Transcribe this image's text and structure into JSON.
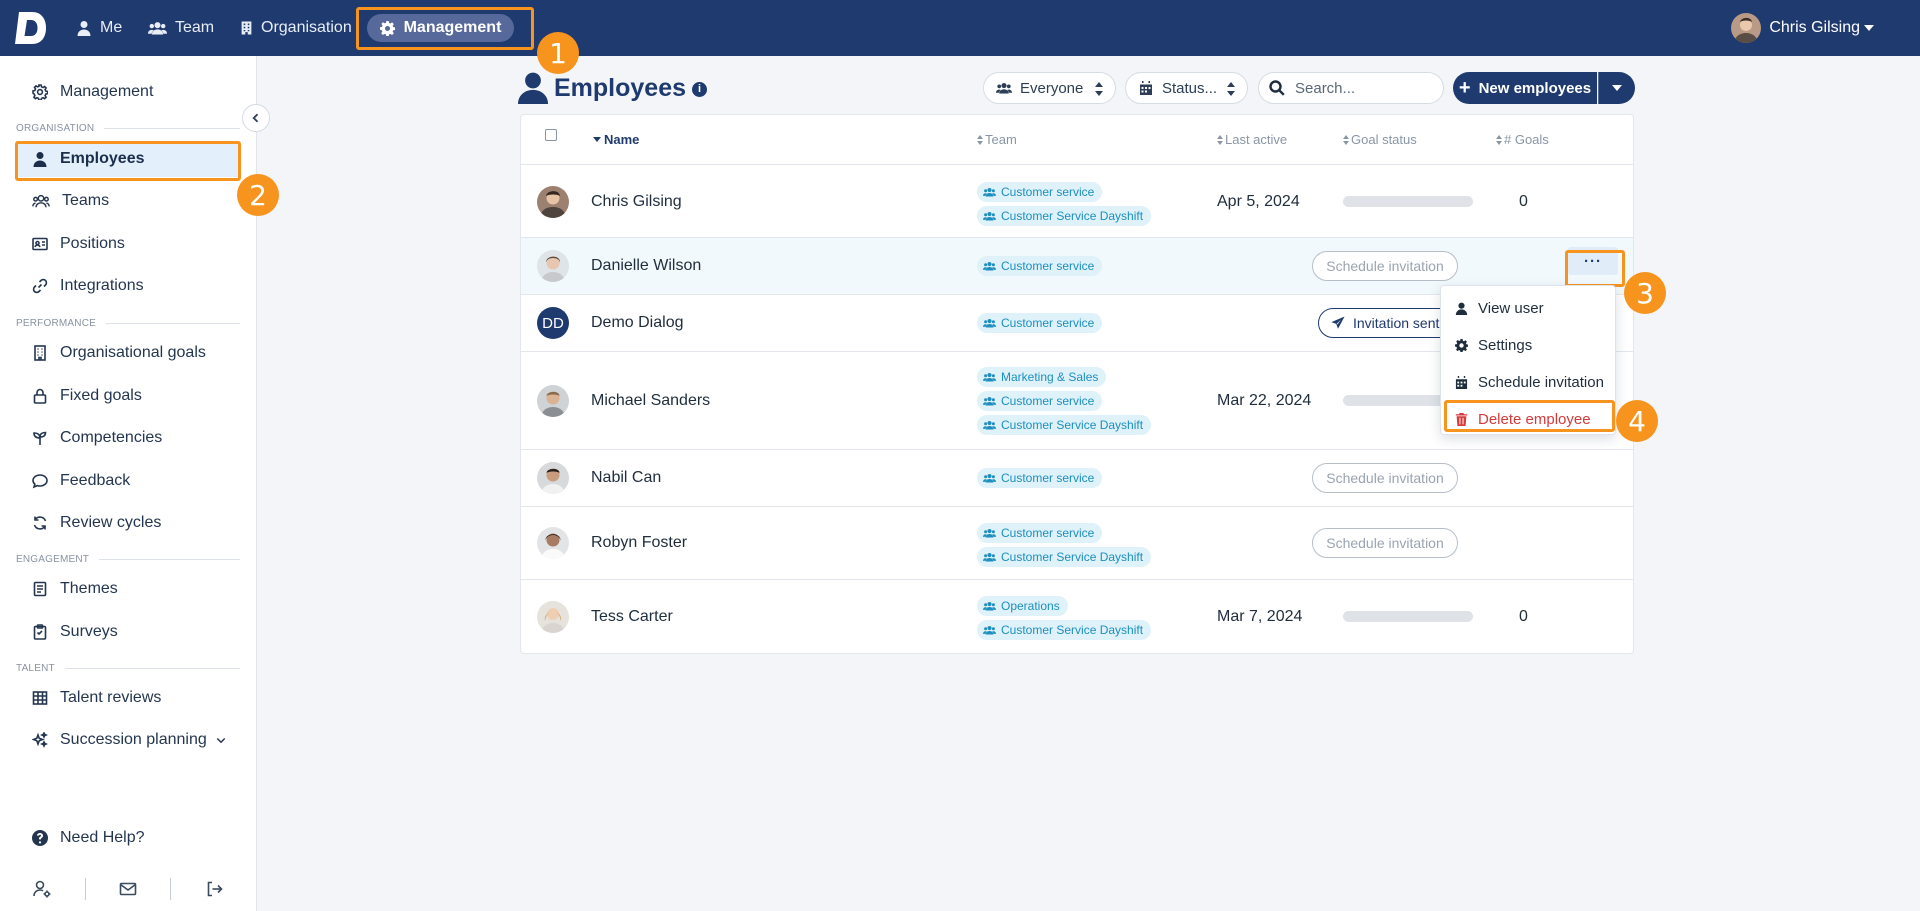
{
  "topbar": {
    "nav": [
      {
        "label": "Me",
        "icon": "user-icon"
      },
      {
        "label": "Team",
        "icon": "users-icon"
      },
      {
        "label": "Organisation",
        "icon": "building-icon"
      },
      {
        "label": "Management",
        "icon": "gear-icon",
        "active": true
      }
    ],
    "user_name": "Chris Gilsing"
  },
  "steps": [
    "1",
    "2",
    "3",
    "4"
  ],
  "sidebar": {
    "top_item": "Management",
    "sections": {
      "organisation": "ORGANISATION",
      "performance": "PERFORMANCE",
      "engagement": "ENGAGEMENT",
      "talent": "TALENT"
    },
    "items": {
      "employees": "Employees",
      "teams": "Teams",
      "positions": "Positions",
      "integrations": "Integrations",
      "org_goals": "Organisational goals",
      "fixed_goals": "Fixed goals",
      "competencies": "Competencies",
      "feedback": "Feedback",
      "review_cycles": "Review cycles",
      "themes": "Themes",
      "surveys": "Surveys",
      "talent_reviews": "Talent reviews",
      "succession": "Succession planning"
    },
    "help": "Need Help?"
  },
  "header": {
    "title": "Employees",
    "filter_everyone": "Everyone",
    "filter_status": "Status...",
    "search_placeholder": "Search...",
    "new_button": "New employees"
  },
  "table": {
    "columns": {
      "name": "Name",
      "team": "Team",
      "last_active": "Last active",
      "goal_status": "Goal status",
      "goals": "# Goals"
    },
    "rows": [
      {
        "name": "Chris Gilsing",
        "teams": [
          "Customer service",
          "Customer Service Dayshift"
        ],
        "last_active": "Apr 5, 2024",
        "goal_progress": 0,
        "goals": "0"
      },
      {
        "name": "Danielle Wilson",
        "teams": [
          "Customer service"
        ],
        "action": "Schedule invitation"
      },
      {
        "name": "Demo Dialog",
        "initials": "DD",
        "teams": [
          "Customer service"
        ],
        "action": "Invitation sent"
      },
      {
        "name": "Michael Sanders",
        "teams": [
          "Marketing & Sales",
          "Customer service",
          "Customer Service Dayshift"
        ],
        "last_active": "Mar 22, 2024",
        "goal_progress": 0
      },
      {
        "name": "Nabil Can",
        "teams": [
          "Customer service"
        ],
        "action": "Schedule invitation"
      },
      {
        "name": "Robyn Foster",
        "teams": [
          "Customer service",
          "Customer Service Dayshift"
        ],
        "action": "Schedule invitation"
      },
      {
        "name": "Tess Carter",
        "teams": [
          "Operations",
          "Customer Service Dayshift"
        ],
        "last_active": "Mar 7, 2024",
        "goal_progress": 0,
        "goals": "0"
      }
    ]
  },
  "row_menu": {
    "more": "···",
    "items": {
      "view_user": "View user",
      "settings": "Settings",
      "schedule": "Schedule invitation",
      "delete": "Delete employee"
    }
  },
  "colors": {
    "brand": "#1f3a6e",
    "highlight": "#f7941d",
    "tag_bg": "#dff2f9",
    "tag_text": "#1c8fbf",
    "danger": "#d63a3a"
  }
}
